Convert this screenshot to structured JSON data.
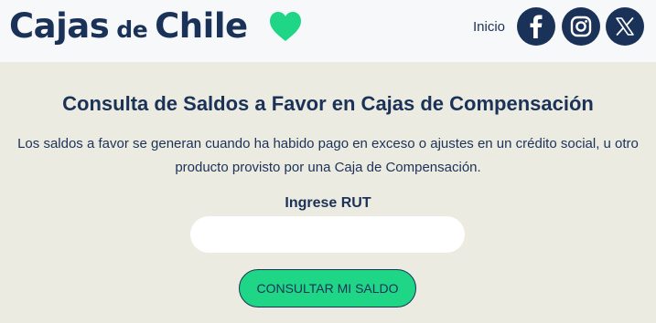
{
  "header": {
    "logo_word1": "Cajas",
    "logo_word2": "de",
    "logo_word3": "Chile",
    "nav_link": "Inicio",
    "social_icons": [
      "facebook-icon",
      "instagram-icon",
      "x-icon"
    ]
  },
  "main": {
    "title": "Consulta de Saldos a Favor en Cajas de Compensación",
    "description": "Los saldos a favor se generan cuando ha habido pago en exceso o ajustes en un crédito social, u otro producto provisto por una Caja de Compensación.",
    "rut_label": "Ingrese RUT",
    "rut_value": "",
    "submit_label": "CONSULTAR MI SALDO"
  },
  "colors": {
    "brand_navy": "#1b3258",
    "accent_green": "#1ed686",
    "page_background": "#ecebe1",
    "header_background": "#f7f8fa"
  }
}
